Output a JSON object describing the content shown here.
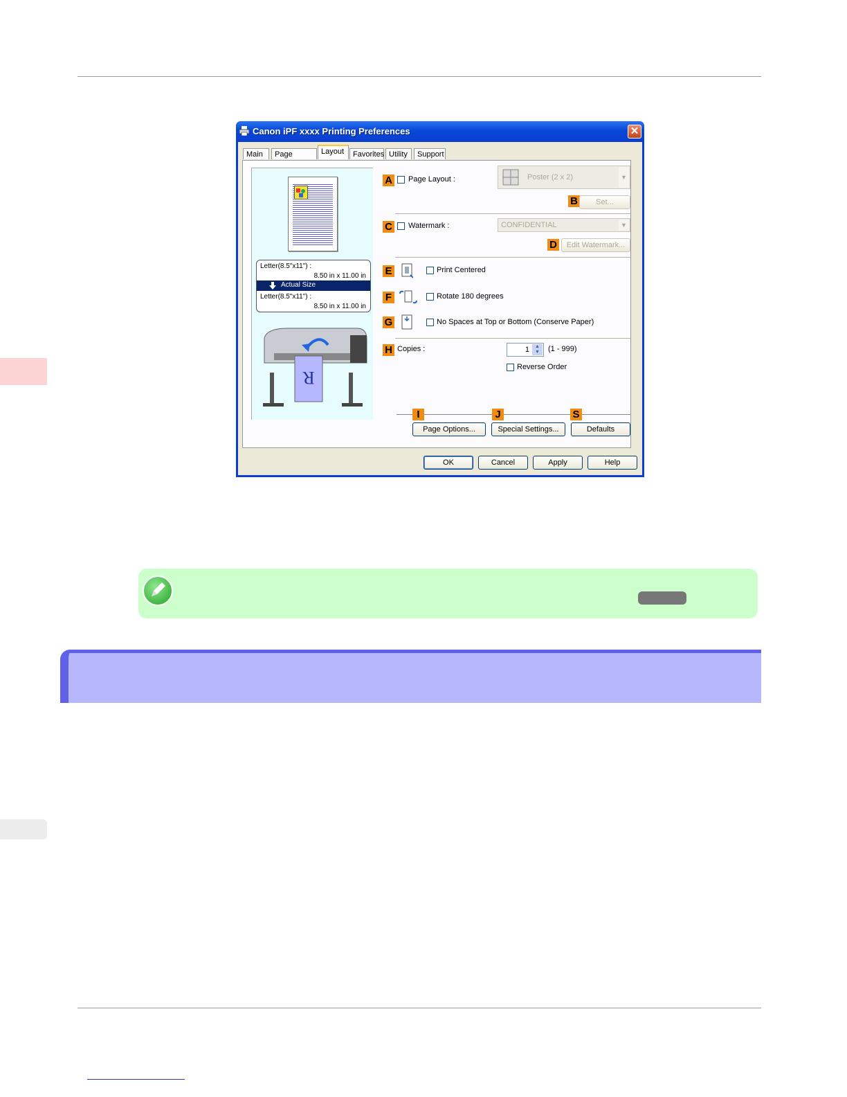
{
  "dialog": {
    "title": "Canon iPF xxxx Printing Preferences",
    "close_glyph": "✕",
    "tabs": [
      {
        "label": "Main"
      },
      {
        "label": "Page Setup"
      },
      {
        "label": "Layout"
      },
      {
        "label": "Favorites"
      },
      {
        "label": "Utility"
      },
      {
        "label": "Support"
      }
    ],
    "active_tab": "Layout",
    "preview": {
      "orig_label": "Letter(8.5\"x11\") :",
      "orig_size": "8.50 in x 11.00 in",
      "scaling": "Actual Size",
      "out_label": "Letter(8.5\"x11\") :",
      "out_size": "8.50 in x 11.00 in",
      "printer_sheet_letter": "R"
    },
    "markers": {
      "A": "A",
      "B": "B",
      "C": "C",
      "D": "D",
      "E": "E",
      "F": "F",
      "G": "G",
      "H": "H",
      "I": "I",
      "J": "J",
      "S": "S"
    },
    "page_layout": {
      "label": "Page Layout :",
      "checked": false,
      "value": "Poster (2 x 2)",
      "set_button": "Set..."
    },
    "watermark": {
      "label": "Watermark :",
      "checked": false,
      "value": "CONFIDENTIAL",
      "edit_button": "Edit Watermark..."
    },
    "print_centered": {
      "label": "Print Centered",
      "checked": false
    },
    "rotate": {
      "label": "Rotate 180 degrees",
      "checked": false
    },
    "no_spaces": {
      "label": "No Spaces at Top or Bottom (Conserve Paper)",
      "checked": false
    },
    "copies": {
      "label": "Copies :",
      "value": "1",
      "range": "(1 - 999)"
    },
    "reverse_order": {
      "label": "Reverse Order",
      "checked": false
    },
    "buttons": {
      "page_options": "Page Options...",
      "special_settings": "Special Settings...",
      "defaults": "Defaults",
      "ok": "OK",
      "cancel": "Cancel",
      "apply": "Apply",
      "help": "Help"
    }
  },
  "colors": {
    "accent_orange": "#f08c14",
    "note_bg": "#ccffcc",
    "section_bg": "#b7b7fb",
    "section_border": "#6060e8",
    "side_tab_pink": "#fcd4d4"
  }
}
